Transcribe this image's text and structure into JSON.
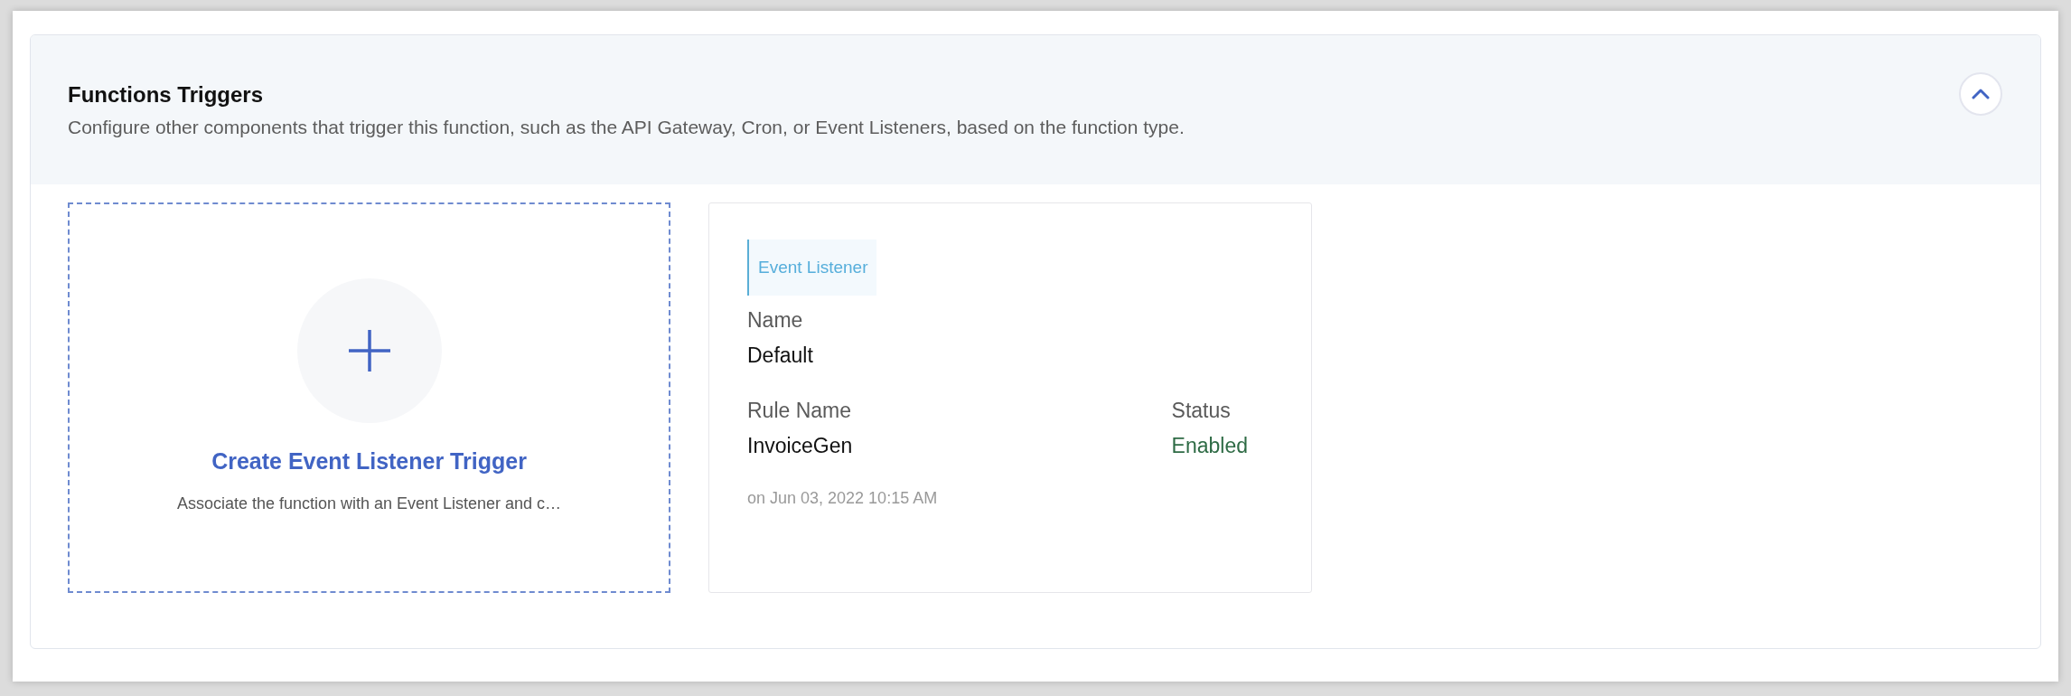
{
  "section": {
    "title": "Functions Triggers",
    "description": "Configure other components that trigger this function, such as the API Gateway, Cron, or Event Listeners, based on the function type.",
    "expanded": true
  },
  "create_card": {
    "title": "Create Event Listener Trigger",
    "description": "Associate the function with an Event Listener and c…"
  },
  "trigger_card": {
    "tag": "Event Listener",
    "name_label": "Name",
    "name_value": "Default",
    "rule_label": "Rule Name",
    "rule_value": "InvoiceGen",
    "status_label": "Status",
    "status_value": "Enabled",
    "timestamp": "on Jun 03, 2022 10:15 AM"
  }
}
